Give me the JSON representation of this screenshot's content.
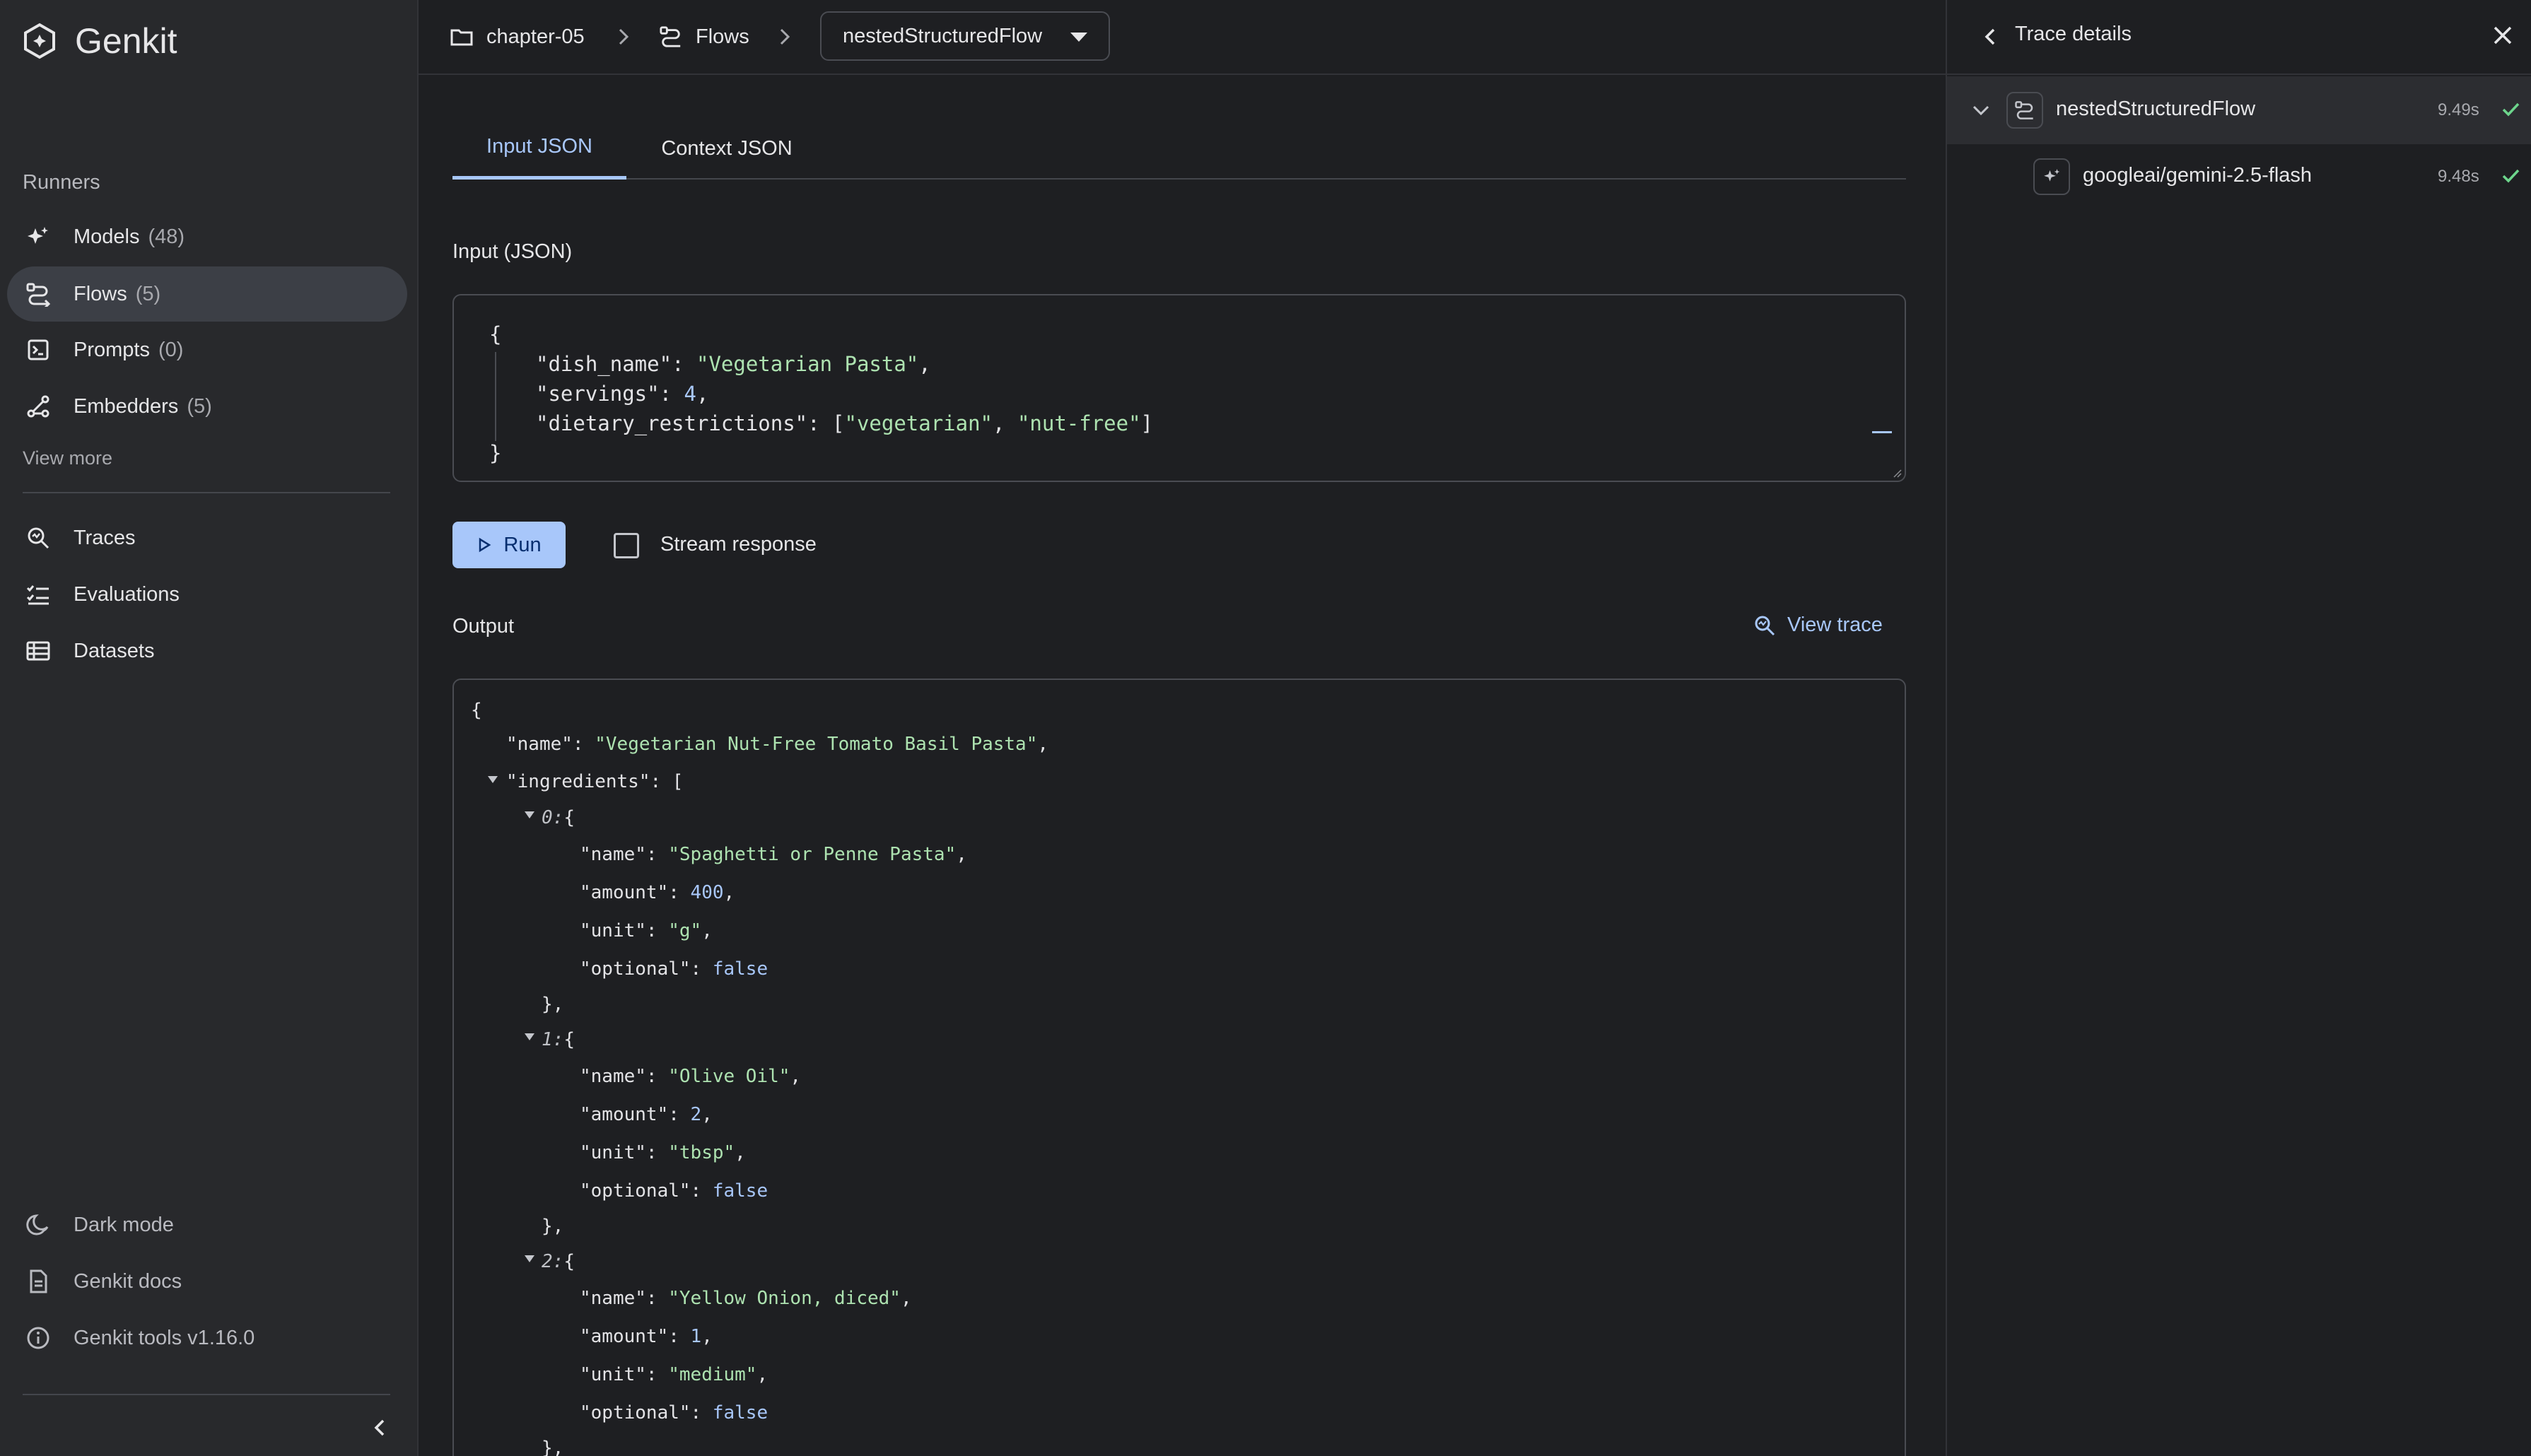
{
  "brand": {
    "name": "Genkit"
  },
  "sidebar": {
    "section_title": "Runners",
    "runners": [
      {
        "label": "Models",
        "count": "(48)",
        "icon": "sparkle-icon"
      },
      {
        "label": "Flows",
        "count": "(5)",
        "icon": "flow-icon",
        "active": true
      },
      {
        "label": "Prompts",
        "count": "(0)",
        "icon": "prompt-icon"
      },
      {
        "label": "Embedders",
        "count": "(5)",
        "icon": "embedder-icon"
      }
    ],
    "view_more": "View more",
    "tools": [
      {
        "label": "Traces",
        "icon": "trace-search-icon"
      },
      {
        "label": "Evaluations",
        "icon": "checklist-icon"
      },
      {
        "label": "Datasets",
        "icon": "table-icon"
      }
    ],
    "footer": [
      {
        "label": "Dark mode",
        "icon": "moon-icon"
      },
      {
        "label": "Genkit docs",
        "icon": "doc-icon"
      },
      {
        "label": "Genkit tools v1.16.0",
        "icon": "info-icon"
      }
    ]
  },
  "breadcrumb": {
    "project": "chapter-05",
    "section": "Flows",
    "selected_flow": "nestedStructuredFlow"
  },
  "main": {
    "tabs": [
      {
        "label": "Input JSON",
        "active": true
      },
      {
        "label": "Context JSON",
        "active": false
      }
    ],
    "input_label": "Input (JSON)",
    "input_json": {
      "open": "{",
      "close": "}",
      "dish_name_key": "\"dish_name\"",
      "dish_name_val": "\"Vegetarian Pasta\"",
      "servings_key": "\"servings\"",
      "servings_val": "4",
      "dietary_key": "\"dietary_restrictions\"",
      "dietary_val_1": "\"vegetarian\"",
      "dietary_val_2": "\"nut-free\""
    },
    "run_label": "Run",
    "stream_label": "Stream response",
    "output_label": "Output",
    "view_trace_label": "View trace",
    "output": {
      "name_key": "\"name\"",
      "name_val": "\"Vegetarian Nut-Free Tomato Basil Pasta\"",
      "ingredients_key": "\"ingredients\"",
      "items": [
        {
          "index": "0:",
          "name": "\"Spaghetti or Penne Pasta\"",
          "amount": "400",
          "unit": "\"g\"",
          "optional": "false"
        },
        {
          "index": "1:",
          "name": "\"Olive Oil\"",
          "amount": "2",
          "unit": "\"tbsp\"",
          "optional": "false"
        },
        {
          "index": "2:",
          "name": "\"Yellow Onion, diced\"",
          "amount": "1",
          "unit": "\"medium\"",
          "optional": "false"
        }
      ]
    }
  },
  "trace": {
    "title": "Trace details",
    "spans": [
      {
        "name": "nestedStructuredFlow",
        "duration": "9.49s",
        "status": "success"
      },
      {
        "name": "googleai/gemini-2.5-flash",
        "duration": "9.48s",
        "status": "success"
      }
    ]
  },
  "colors": {
    "accent": "#a8c7fa",
    "success": "#6dd58c",
    "string": "#ade2b0",
    "sidebar_bg": "#28292c",
    "main_bg": "#1e1f22"
  }
}
